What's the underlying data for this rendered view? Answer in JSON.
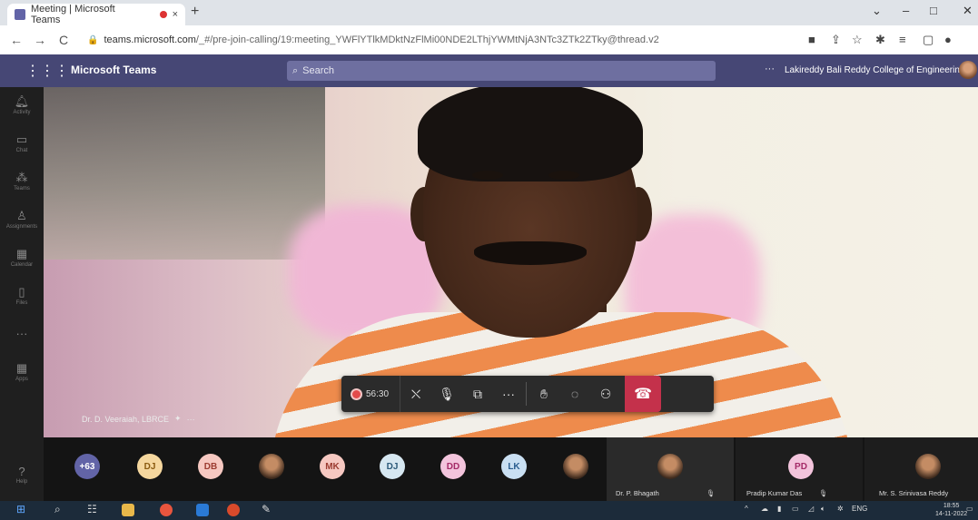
{
  "browser": {
    "tab_title": "Meeting | Microsoft Teams",
    "new_tab": "+",
    "close_tab": "×",
    "url_host": "teams.microsoft.com",
    "url_path": "/_#/pre-join-calling/19:meeting_YWFlYTlkMDktNzFlMi00NDE2LThjYWMtNjA3NTc3ZTk2ZTky@thread.v2",
    "min": "–",
    "max": "□",
    "close": "✕"
  },
  "teams": {
    "app_name": "Microsoft Teams",
    "search_placeholder": "Search",
    "more": "···",
    "org": "Lakireddy Bali Reddy College of Engineering"
  },
  "rail": {
    "items": [
      {
        "label": "Activity",
        "icon": "bell-icon"
      },
      {
        "label": "Chat",
        "icon": "chat-icon"
      },
      {
        "label": "Teams",
        "icon": "teams-icon"
      },
      {
        "label": "Assignments",
        "icon": "assignments-icon"
      },
      {
        "label": "Calendar",
        "icon": "calendar-icon"
      },
      {
        "label": "Files",
        "icon": "files-icon"
      },
      {
        "label": "···",
        "icon": "more-icon"
      },
      {
        "label": "Apps",
        "icon": "apps-icon"
      },
      {
        "label": "Help",
        "icon": "help-icon"
      }
    ]
  },
  "stage": {
    "speaker_name": "Dr. D. Veeraiah, LBRCE",
    "speaker_more": "···"
  },
  "callbar": {
    "timer": "56:30",
    "recording": true
  },
  "participants": {
    "overflow": "+63",
    "avatars": [
      {
        "initials": "DJ",
        "bg": "#f5d79e",
        "fg": "#8a5a10"
      },
      {
        "initials": "DB",
        "bg": "#f6c8c1",
        "fg": "#9b3b30"
      },
      {
        "initials": "",
        "bg": "#8a6a50",
        "fg": "#fff",
        "photo": true
      },
      {
        "initials": "MK",
        "bg": "#f6c8c1",
        "fg": "#9b3b30"
      },
      {
        "initials": "DJ",
        "bg": "#d6e7f1",
        "fg": "#2c5a7a"
      },
      {
        "initials": "DD",
        "bg": "#f3c4dc",
        "fg": "#a42a67"
      },
      {
        "initials": "LK",
        "bg": "#c9dff2",
        "fg": "#2a5d8f"
      },
      {
        "initials": "",
        "bg": "#6b4b3a",
        "fg": "#fff",
        "photo": true
      }
    ],
    "tiles": [
      {
        "name": "Dr. P. Bhagath",
        "initials": "",
        "photo": true
      },
      {
        "name": "Pradip Kumar Das",
        "initials": "PD",
        "photo": false
      },
      {
        "name": "Mr. S. Srinivasa Reddy",
        "initials": "",
        "photo": true
      }
    ]
  },
  "taskbar": {
    "language": "ENG",
    "time": "18:55",
    "date": "14-11-2022"
  }
}
